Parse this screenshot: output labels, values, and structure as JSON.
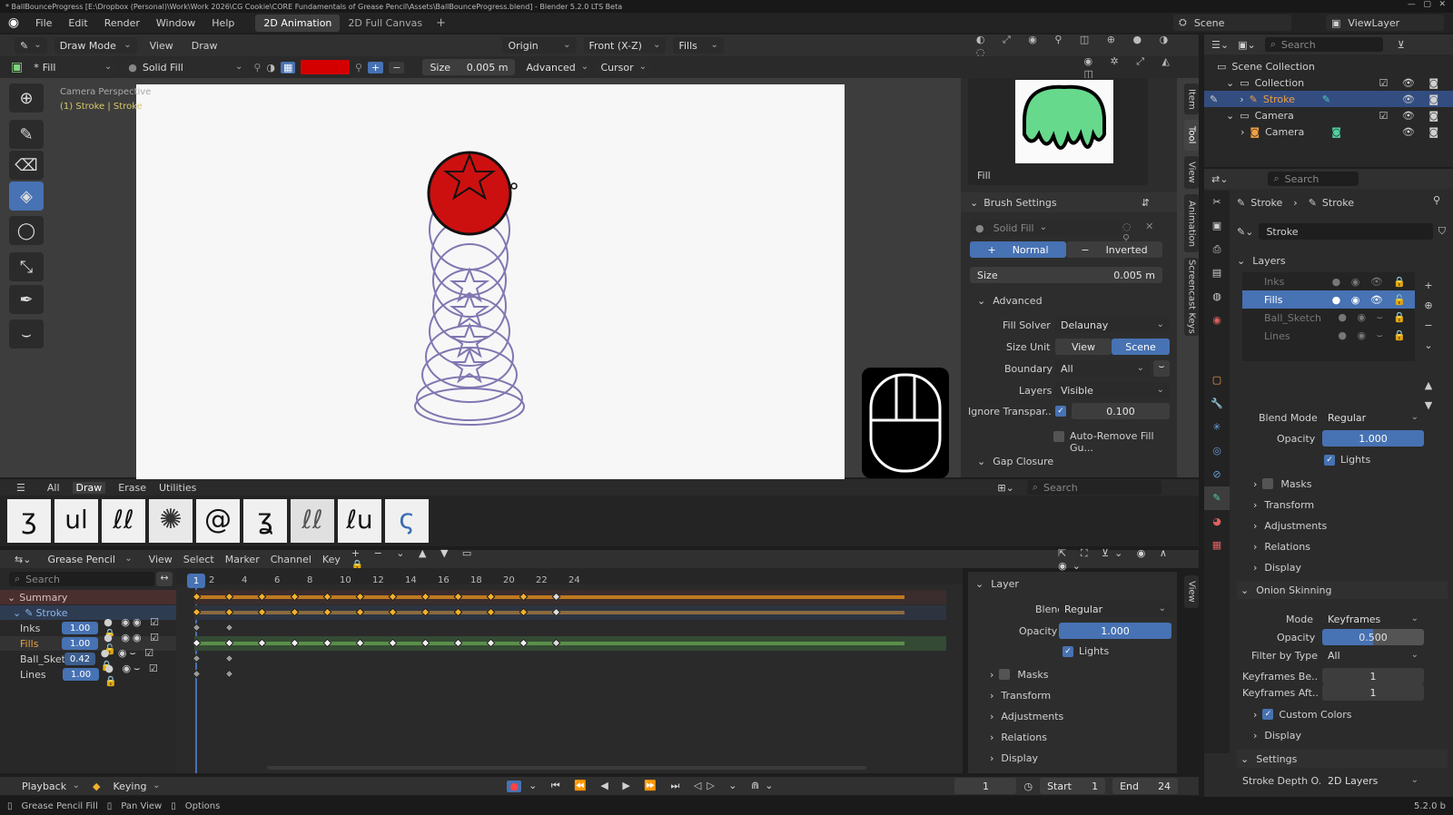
{
  "title_bar": {
    "text": "* BallBounceProgress [E:\\Dropbox (Personal)\\Work\\Work 2026\\CG Cookie\\CORE Fundamentals of Grease Pencil\\Assets\\BallBounceProgress.blend] - Blender 5.2.0 LTS Beta"
  },
  "menu": {
    "items": [
      "File",
      "Edit",
      "Render",
      "Window",
      "Help"
    ],
    "workspaces": [
      "2D Animation",
      "2D Full Canvas"
    ],
    "add": "+",
    "scene": "Scene",
    "view_layer": "ViewLayer"
  },
  "viewport_header": {
    "mode": "Draw Mode",
    "view": "View",
    "draw": "Draw",
    "origin": "Origin",
    "axis": "Front (X-Z)",
    "layer": "Fills"
  },
  "tool_settings": {
    "brush": "Fill",
    "material": "Solid Fill",
    "size_label": "Size",
    "size_value": "0.005 m",
    "advanced": "Advanced",
    "cursor": "Cursor",
    "color": "#d40000"
  },
  "viewport": {
    "camera_label": "Camera Perspective",
    "object_label": "(1) Stroke | Stroke"
  },
  "brush_panel": {
    "preview_label": "Fill",
    "section": "Brush Settings",
    "material": "Solid Fill",
    "normal": "Normal",
    "inverted": "Inverted",
    "size_label": "Size",
    "size_value": "0.005 m",
    "advanced": "Advanced",
    "fill_solver_label": "Fill Solver",
    "fill_solver": "Delaunay",
    "size_unit_label": "Size Unit",
    "size_unit_view": "View",
    "size_unit_scene": "Scene",
    "boundary_label": "Boundary",
    "boundary": "All",
    "layers_label": "Layers",
    "layers": "Visible",
    "ignore_label": "Ignore Transpar...",
    "ignore_value": "0.100",
    "auto_remove": "Auto-Remove Fill Gu...",
    "gap_closure": "Gap Closure"
  },
  "side_tabs": [
    "Item",
    "Tool",
    "View",
    "Animation",
    "Screencast Keys"
  ],
  "asset_shelf": {
    "tabs": [
      "All",
      "Draw",
      "Erase",
      "Utilities"
    ],
    "search": "Search"
  },
  "dopesheet": {
    "editor": "Grease Pencil",
    "menus": [
      "View",
      "Select",
      "Marker",
      "Channel",
      "Key"
    ],
    "search": "Search",
    "frames": [
      "2",
      "4",
      "6",
      "8",
      "10",
      "12",
      "14",
      "16",
      "18",
      "20",
      "22",
      "24"
    ],
    "current_frame": "1",
    "channels": [
      {
        "name": "Summary",
        "value": ""
      },
      {
        "name": "Stroke",
        "value": ""
      },
      {
        "name": "Inks",
        "value": "1.00"
      },
      {
        "name": "Fills",
        "value": "1.00"
      },
      {
        "name": "Ball_Sketch",
        "value": "0.42"
      },
      {
        "name": "Lines",
        "value": "1.00"
      }
    ]
  },
  "layer_panel": {
    "title": "Layer",
    "blend_label": "Blend",
    "blend": "Regular",
    "opacity_label": "Opacity",
    "opacity": "1.000",
    "lights": "Lights",
    "items": [
      "Masks",
      "Transform",
      "Adjustments",
      "Relations",
      "Display"
    ],
    "side_tab": "View"
  },
  "playback": {
    "playback": "Playback",
    "keying": "Keying",
    "frame": "1",
    "start_label": "Start",
    "start": "1",
    "end_label": "End",
    "end": "24"
  },
  "status_bar": {
    "items": [
      "Grease Pencil Fill",
      "Pan View",
      "Options"
    ],
    "version": "5.2.0 b"
  },
  "outliner": {
    "search": "Search",
    "rows": [
      {
        "name": "Scene Collection",
        "indent": 0
      },
      {
        "name": "Collection",
        "indent": 1
      },
      {
        "name": "Stroke",
        "indent": 2
      },
      {
        "name": "Camera",
        "indent": 1
      },
      {
        "name": "Camera",
        "indent": 2
      }
    ]
  },
  "properties": {
    "search": "Search",
    "breadcrumb": [
      "Stroke",
      "Stroke"
    ],
    "object_name": "Stroke",
    "layers_title": "Layers",
    "layers": [
      "Inks",
      "Fills",
      "Ball_Sketch",
      "Lines"
    ],
    "blend_mode_label": "Blend Mode",
    "blend_mode": "Regular",
    "opacity_label": "Opacity",
    "opacity": "1.000",
    "lights": "Lights",
    "items": [
      "Masks",
      "Transform",
      "Adjustments",
      "Relations",
      "Display"
    ],
    "onion_title": "Onion Skinning",
    "mode_label": "Mode",
    "mode": "Keyframes",
    "onion_opacity_label": "Opacity",
    "onion_opacity": "0.500",
    "filter_label": "Filter by Type",
    "filter": "All",
    "kf_before_label": "Keyframes Be...",
    "kf_before": "1",
    "kf_after_label": "Keyframes Aft...",
    "kf_after": "1",
    "custom_colors": "Custom Colors",
    "display": "Display",
    "settings_title": "Settings",
    "stroke_depth_label": "Stroke Depth O...",
    "stroke_depth": "2D Layers"
  }
}
